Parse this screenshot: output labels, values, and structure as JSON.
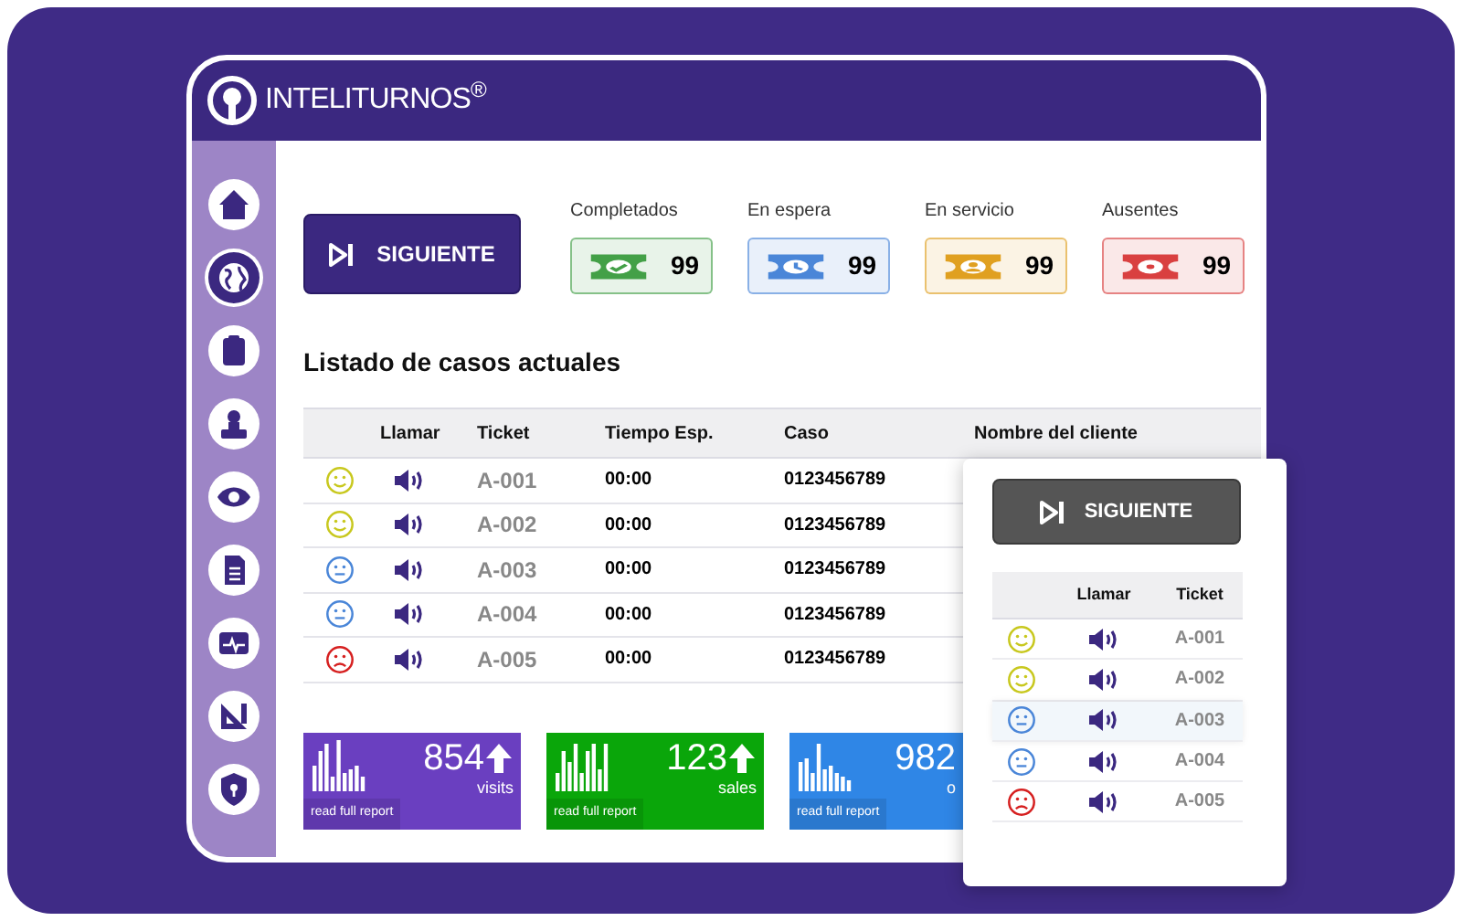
{
  "header": {
    "brand": "INTELITURNOS$^{®}$"
  },
  "sidebar": {
    "items": [
      {
        "kind": "home",
        "selected": false
      },
      {
        "kind": "globe",
        "selected": true
      },
      {
        "kind": "clipboard",
        "selected": false
      },
      {
        "kind": "person",
        "selected": false
      },
      {
        "kind": "eye",
        "selected": false
      },
      {
        "kind": "document",
        "selected": false
      },
      {
        "kind": "monitor",
        "selected": false
      },
      {
        "kind": "ruler",
        "selected": false
      },
      {
        "kind": "shield",
        "selected": false
      }
    ]
  },
  "next_button": {
    "label": "SIGUIENTE"
  },
  "stats": [
    {
      "label": "Completados",
      "value": "99",
      "kind": "completed",
      "color": "#43a047"
    },
    {
      "label": "En espera",
      "value": "99",
      "kind": "waiting",
      "color": "#4a86d8"
    },
    {
      "label": "En servicio",
      "value": "99",
      "kind": "serving",
      "color": "#e0a020"
    },
    {
      "label": "Ausentes",
      "value": "99",
      "kind": "absent",
      "color": "#d94040"
    }
  ],
  "cases": {
    "title": "Listado de casos actuales",
    "columns": [
      "Llamar",
      "Ticket",
      "Tiempo Esp.",
      "Caso",
      "Nombre del cliente"
    ],
    "rows": [
      {
        "kind": "happy",
        "ticket": "A-001",
        "wait": "00:00",
        "case": "0123456789"
      },
      {
        "kind": "happy",
        "ticket": "A-002",
        "wait": "00:00",
        "case": "0123456789"
      },
      {
        "kind": "neutral",
        "ticket": "A-003",
        "wait": "00:00",
        "case": "0123456789"
      },
      {
        "kind": "neutral",
        "ticket": "A-004",
        "wait": "00:00",
        "case": "0123456789"
      },
      {
        "kind": "sad",
        "ticket": "A-005",
        "wait": "00:00",
        "case": "0123456789"
      }
    ]
  },
  "report_cards": [
    {
      "value": "854",
      "label": "visits",
      "arrow": true,
      "link": "read full report",
      "color": "#6a3fc0"
    },
    {
      "value": "123",
      "label": "sales",
      "arrow": true,
      "link": "read full report",
      "color": "#0aa60a"
    },
    {
      "value": "982",
      "label": "o",
      "arrow": false,
      "link": "read full report",
      "color": "#2f86e6"
    }
  ],
  "popup": {
    "button": {
      "label": "SIGUIENTE"
    },
    "columns": [
      "Llamar",
      "Ticket"
    ],
    "rows": [
      {
        "kind": "happy",
        "ticket": "A-001",
        "highlighted": false
      },
      {
        "kind": "happy",
        "ticket": "A-002",
        "highlighted": false
      },
      {
        "kind": "neutral",
        "ticket": "A-003",
        "highlighted": true
      },
      {
        "kind": "neutral",
        "ticket": "A-004",
        "highlighted": false
      },
      {
        "kind": "sad",
        "ticket": "A-005",
        "highlighted": false
      }
    ]
  }
}
